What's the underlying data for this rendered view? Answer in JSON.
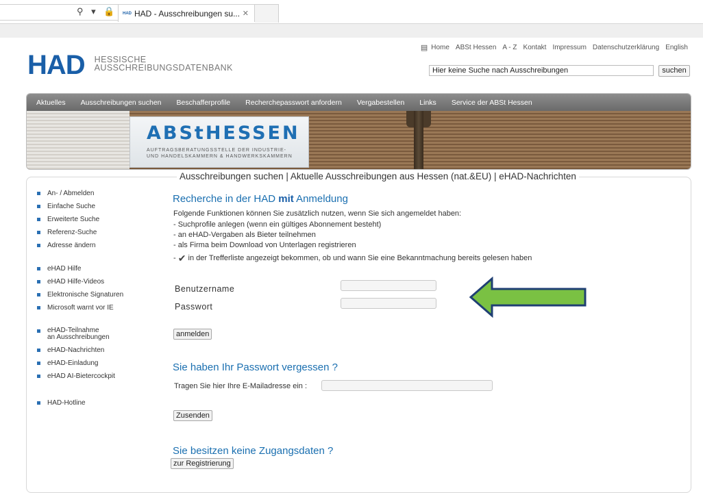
{
  "browser": {
    "tab_favicon": "HAD",
    "tab_title": "HAD - Ausschreibungen su...",
    "tab_close": "✕",
    "addr_icons": "⚲ ▾ 🔒"
  },
  "top_links": [
    "Home",
    "ABSt Hessen",
    "A - Z",
    "Kontakt",
    "Impressum",
    "Datenschutzerklärung",
    "English"
  ],
  "logo": {
    "main": "HAD",
    "line1": "HESSISCHE",
    "line2": "AUSSCHREIBUNGSDATENBANK"
  },
  "search": {
    "value": "Hier keine Suche nach Ausschreibungen",
    "button": "suchen"
  },
  "nav": [
    "Aktuelles",
    "Ausschreibungen suchen",
    "Beschafferprofile",
    "Recherchepasswort anfordern",
    "Vergabestellen",
    "Links",
    "Service der ABSt Hessen"
  ],
  "banner": {
    "title": "ABStHESSEN",
    "sub1": "AUFTRAGSBERATUNGSSTELLE DER INDUSTRIE-",
    "sub2": "UND HANDELSKAMMERN & HANDWERKSKAMMERN"
  },
  "subtitle": "Ausschreibungen suchen | Aktuelle Ausschreibungen aus Hessen (nat.&EU) | eHAD-Nachrichten",
  "sidebar": {
    "group1": [
      "An- / Abmelden",
      "Einfache Suche",
      "Erweiterte Suche",
      "Referenz-Suche",
      "Adresse ändern"
    ],
    "group2": [
      "eHAD Hilfe",
      "eHAD Hilfe-Videos",
      "Elektronische Signaturen",
      "Microsoft warnt vor IE"
    ],
    "group3_first_line1": "eHAD-Teilnahme",
    "group3_first_line2": "an Ausschreibungen",
    "group3": [
      "eHAD-Nachrichten",
      "eHAD-Einladung",
      "eHAD AI-Bietercockpit"
    ],
    "group4": [
      "HAD-Hotline"
    ]
  },
  "main": {
    "heading_pre": "Recherche in der HAD ",
    "heading_bold": "mit",
    "heading_post": " Anmeldung",
    "intro": "Folgende Funktionen können Sie zusätzlich nutzen, wenn Sie sich angemeldet haben:",
    "bullets": [
      "- Suchprofile anlegen (wenn ein gültiges Abonnement besteht)",
      "- an eHAD-Vergaben als Bieter teilnehmen",
      "- als Firma beim Download von Unterlagen registrieren"
    ],
    "check_prefix": "- ",
    "check_glyph": "✔",
    "check_text": " in der Trefferliste angezeigt bekommen, ob und wann Sie eine Bekanntmachung bereits gelesen haben",
    "username_label": "Benutzername",
    "password_label": "Passwort",
    "login_button": "anmelden",
    "forgot_heading": "Sie haben Ihr Passwort vergessen ?",
    "email_label": "Tragen Sie hier Ihre E-Mailadresse ein :",
    "send_button": "Zusenden",
    "noaccess_heading": "Sie besitzen keine Zugangsdaten ?",
    "register_button": "zur Registrierung"
  },
  "colors": {
    "brand": "#1a5fa8",
    "arrow_fill": "#7ac143",
    "arrow_stroke": "#1f3f73"
  }
}
